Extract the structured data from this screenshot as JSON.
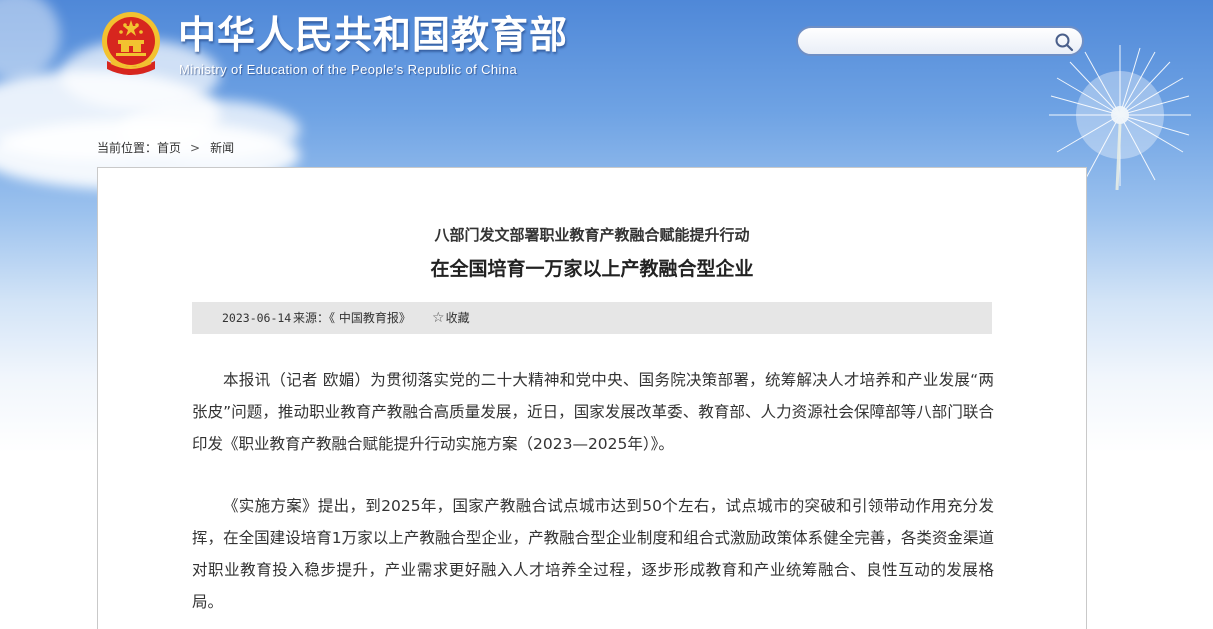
{
  "header": {
    "site_title": "中华人民共和国教育部",
    "site_subtitle": "Ministry of Education of the People's Republic of China"
  },
  "search": {
    "value": "",
    "placeholder": ""
  },
  "breadcrumb": {
    "prefix": "当前位置：",
    "home": "首页",
    "separator": ">",
    "current": "新闻"
  },
  "article": {
    "subhead": "八部门发文部署职业教育产教融合赋能提升行动",
    "title": "在全国培育一万家以上产教融合型企业",
    "meta": {
      "date": "2023-06-14",
      "source": "来源：《 中国教育报》",
      "favorite_icon": "star-icon",
      "favorite_label": "收藏"
    },
    "paragraphs": [
      "本报讯（记者 欧媚）为贯彻落实党的二十大精神和党中央、国务院决策部署，统筹解决人才培养和产业发展“两张皮”问题，推动职业教育产教融合高质量发展，近日，国家发展改革委、教育部、人力资源社会保障部等八部门联合印发《职业教育产教融合赋能提升行动实施方案（2023—2025年）》。",
      "《实施方案》提出，到2025年，国家产教融合试点城市达到50个左右，试点城市的突破和引领带动作用充分发挥，在全国建设培育1万家以上产教融合型企业，产教融合型企业制度和组合式激励政策体系健全完善，各类资金渠道对职业教育投入稳步提升，产业需求更好融入人才培养全过程，逐步形成教育和产业统筹融合、良性互动的发展格局。"
    ]
  },
  "colors": {
    "sky_top": "#4f88d8",
    "emblem_red": "#d7261e",
    "emblem_gold": "#f2c230",
    "meta_bar_bg": "#e6e6e6"
  }
}
